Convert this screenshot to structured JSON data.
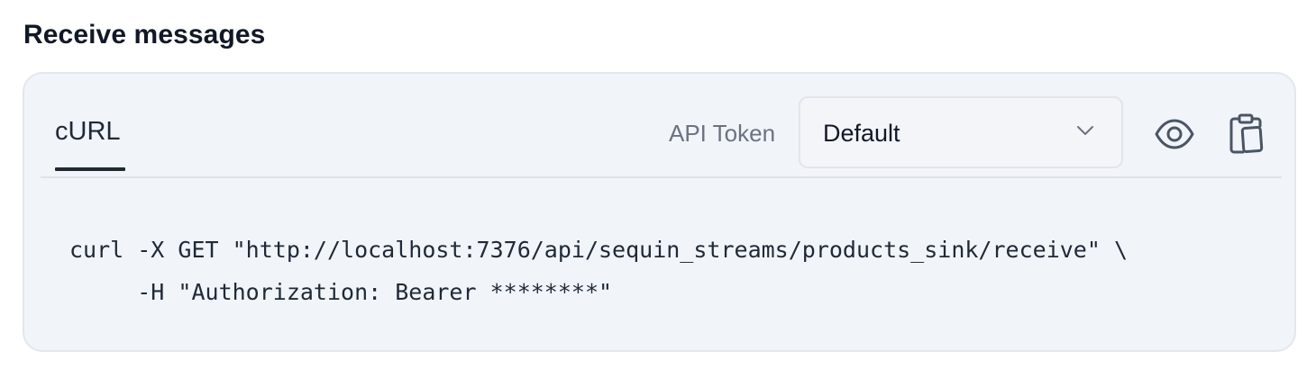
{
  "section": {
    "title": "Receive messages"
  },
  "tabs": [
    {
      "label": "cURL",
      "active": true
    }
  ],
  "token": {
    "label": "API Token",
    "selected": "Default"
  },
  "actions": {
    "reveal_icon": "eye-icon",
    "copy_icon": "clipboard-copy-icon"
  },
  "code": {
    "line1": "curl -X GET \"http://localhost:7376/api/sequin_streams/products_sink/receive\" \\",
    "line2": "     -H \"Authorization: Bearer ********\""
  },
  "colors": {
    "card_background": "#f1f4f9",
    "card_border": "#e3e7ee",
    "text_primary": "#111827",
    "text_muted": "#6b7280"
  }
}
